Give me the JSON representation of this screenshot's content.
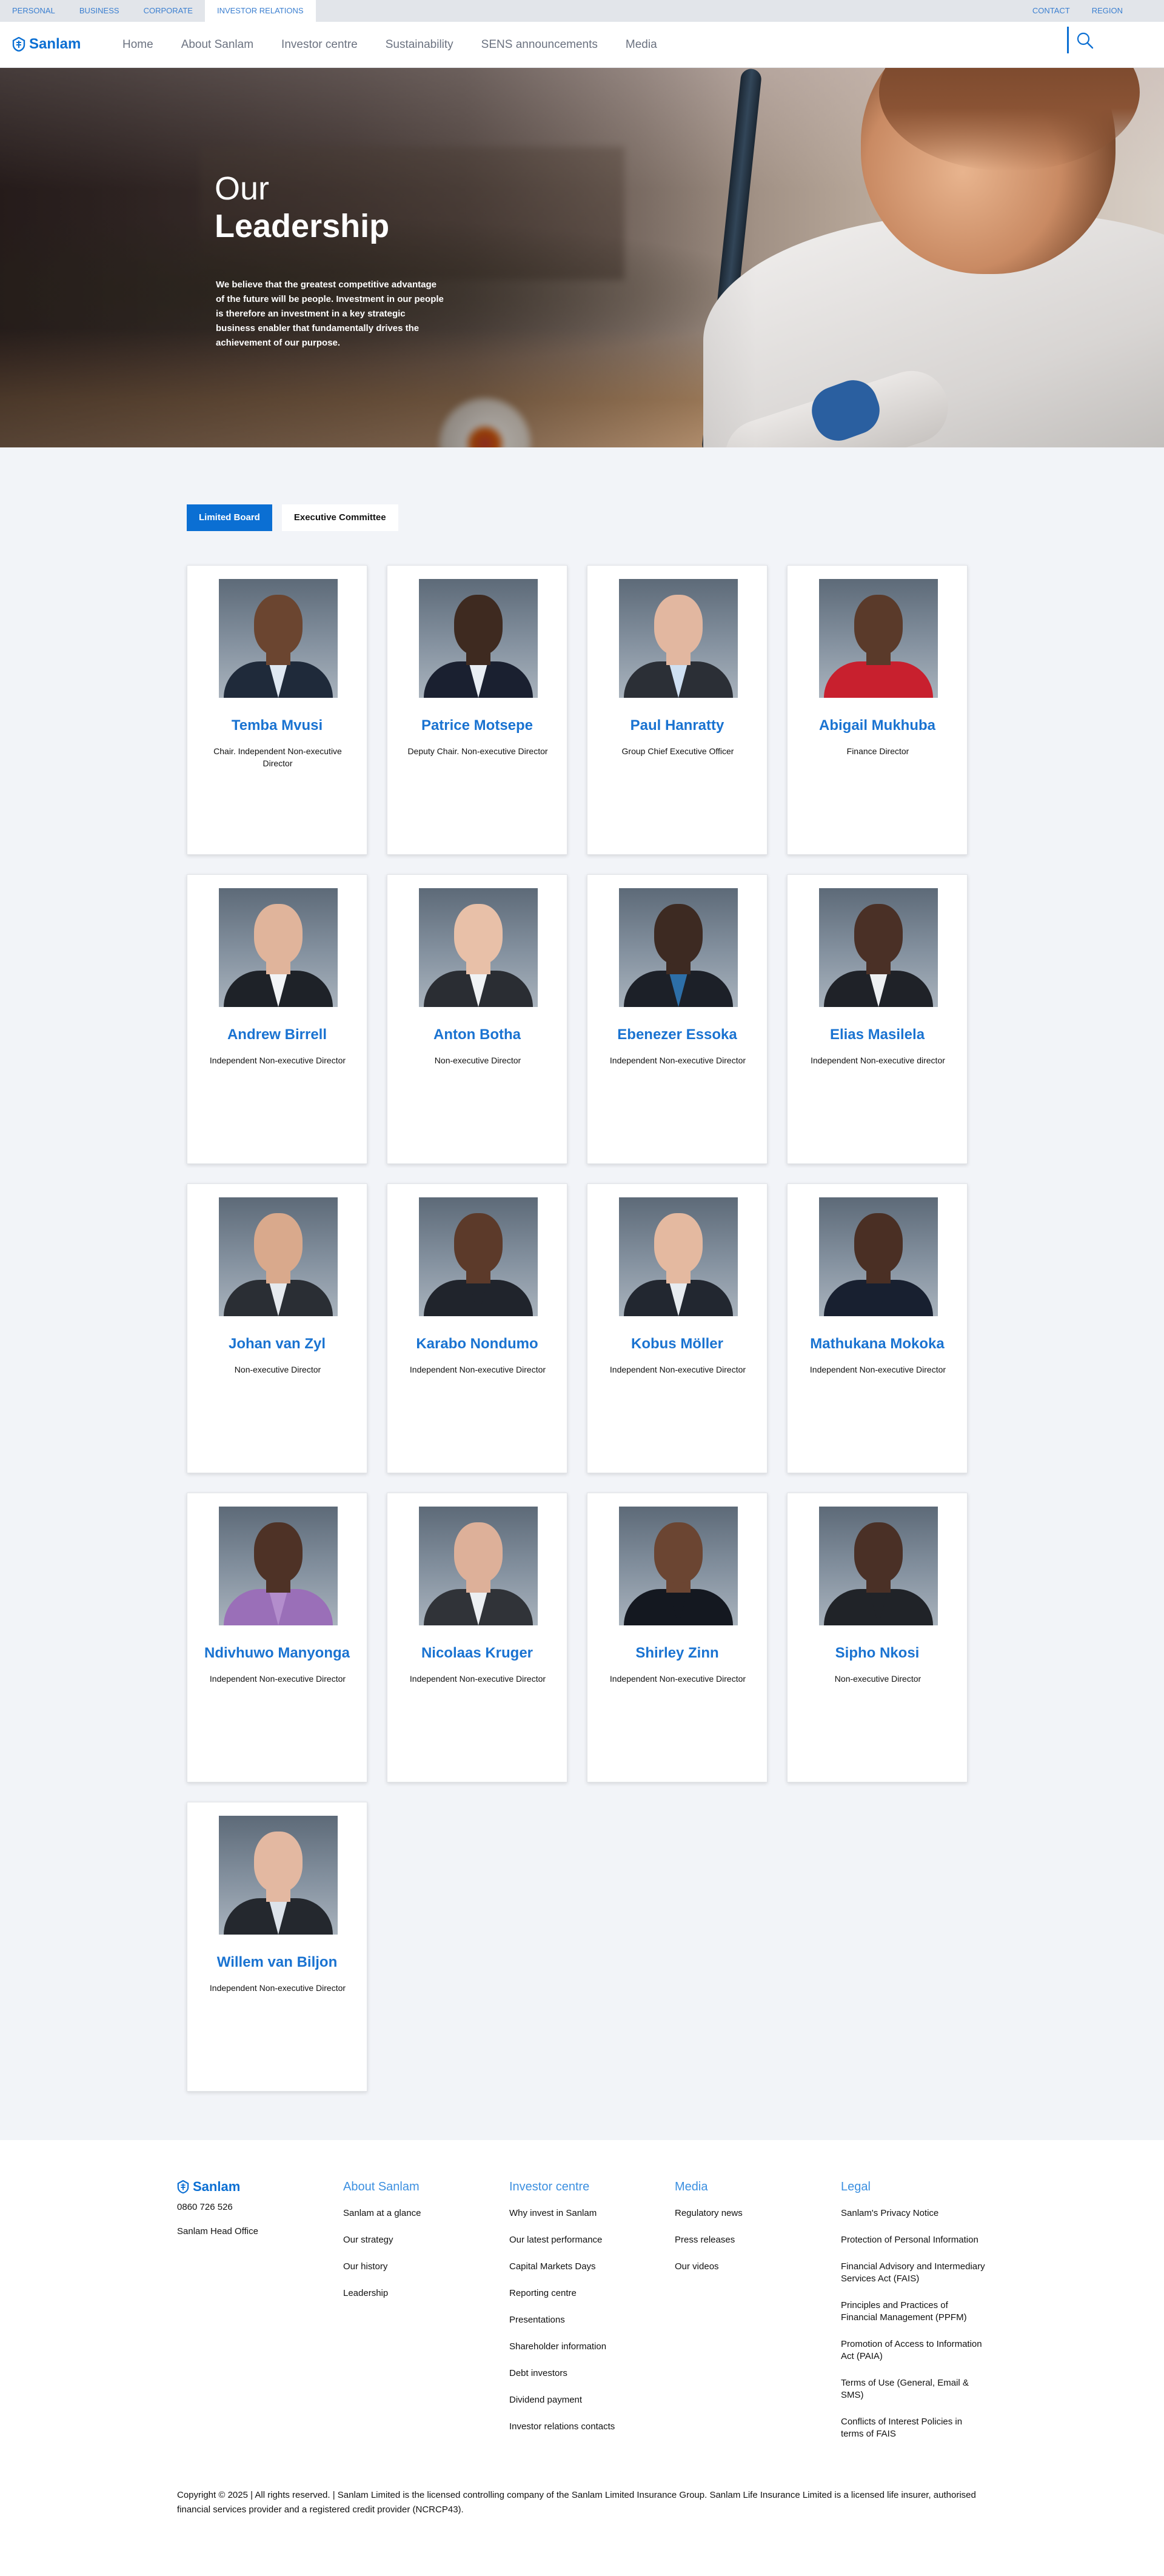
{
  "utility_nav": {
    "items": [
      "PERSONAL",
      "BUSINESS",
      "CORPORATE",
      "INVESTOR RELATIONS"
    ],
    "active": "INVESTOR RELATIONS",
    "right": [
      "CONTACT",
      "REGION"
    ]
  },
  "brand": {
    "name": "Sanlam",
    "color": "#0b6fd3"
  },
  "main_nav": [
    "Home",
    "About Sanlam",
    "Investor centre",
    "Sustainability",
    "SENS announcements",
    "Media"
  ],
  "hero": {
    "title_line1": "Our",
    "title_line2": "Leadership",
    "text": "We believe that the greatest competitive advantage of the future will be people. Investment in our people is therefore an investment in a key strategic business enabler that fundamentally drives the achievement of our purpose."
  },
  "tabs": [
    {
      "label": "Limited Board",
      "active": true
    },
    {
      "label": "Executive Committee",
      "active": false
    }
  ],
  "people": [
    {
      "name": "Temba Mvusi",
      "role": "Chair. Independent Non-executive Director",
      "skin": "#6b4530",
      "suit": "#1f2a3a",
      "shirt": "#dfe8f2"
    },
    {
      "name": "Patrice Motsepe",
      "role": "Deputy Chair. Non-executive Director",
      "skin": "#3e2a20",
      "suit": "#1a2030",
      "shirt": "#e9eef4"
    },
    {
      "name": "Paul Hanratty",
      "role": "Group Chief Executive Officer",
      "skin": "#e2b7a0",
      "suit": "#2b2f36",
      "shirt": "#cfe0f2"
    },
    {
      "name": "Abigail Mukhuba",
      "role": "Finance Director",
      "skin": "#5a3a2a",
      "suit": "#c8202e",
      "shirt": "#c8202e"
    },
    {
      "name": "Andrew Birrell",
      "role": "Independent Non-executive Director",
      "skin": "#e0b49b",
      "suit": "#1e2228",
      "shirt": "#f2f4f6"
    },
    {
      "name": "Anton Botha",
      "role": "Non-executive Director",
      "skin": "#e8c0a8",
      "suit": "#2a2d33",
      "shirt": "#f0f2f4"
    },
    {
      "name": "Ebenezer Essoka",
      "role": "Independent Non-executive Director",
      "skin": "#3d2a22",
      "suit": "#1c2028",
      "shirt": "#2d6fa8"
    },
    {
      "name": "Elias Masilela",
      "role": "Independent Non-executive director",
      "skin": "#4a3026",
      "suit": "#1f2228",
      "shirt": "#eef0f2"
    },
    {
      "name": "Johan van Zyl",
      "role": "Non-executive Director",
      "skin": "#d9a98c",
      "suit": "#2a2e34",
      "shirt": "#e6eaee"
    },
    {
      "name": "Karabo Nondumo",
      "role": "Independent Non-executive Director",
      "skin": "#5c3a2a",
      "suit": "#20242c",
      "shirt": "#20242c"
    },
    {
      "name": "Kobus Möller",
      "role": "Independent Non-executive Director",
      "skin": "#e4b9a0",
      "suit": "#222730",
      "shirt": "#e8ecf0"
    },
    {
      "name": "Mathukana Mokoka",
      "role": "Independent Non-executive Director",
      "skin": "#4a2f24",
      "suit": "#182030",
      "shirt": "#182030"
    },
    {
      "name": "Ndivhuwo Manyonga",
      "role": "Independent Non-executive Director",
      "skin": "#4e3226",
      "suit": "#9a6fb8",
      "shirt": "#b38dcc"
    },
    {
      "name": "Nicolaas Kruger",
      "role": "Independent Non-executive Director",
      "skin": "#ddb099",
      "suit": "#303338",
      "shirt": "#eceff2"
    },
    {
      "name": "Shirley Zinn",
      "role": "Independent Non-executive Director",
      "skin": "#6b4532",
      "suit": "#141820",
      "shirt": "#141820"
    },
    {
      "name": "Sipho Nkosi",
      "role": "Non-executive Director",
      "skin": "#4a3026",
      "suit": "#202328",
      "shirt": "#202328"
    },
    {
      "name": "Willem van Biljon",
      "role": "Independent Non-executive Director",
      "skin": "#e3b8a1",
      "suit": "#24282e",
      "shirt": "#dde3ea"
    }
  ],
  "footer": {
    "phone": "0860 726 526",
    "office": "Sanlam Head Office",
    "columns": [
      {
        "title": "About Sanlam",
        "links": [
          "Sanlam at a glance",
          "Our strategy",
          "Our history",
          "Leadership"
        ]
      },
      {
        "title": "Investor centre",
        "links": [
          "Why invest in Sanlam",
          "Our latest performance",
          "Capital Markets Days",
          "Reporting centre",
          "Presentations",
          "Shareholder information",
          "Debt investors",
          "Dividend payment",
          "Investor relations contacts"
        ]
      },
      {
        "title": "Media",
        "links": [
          "Regulatory news",
          "Press releases",
          "Our videos"
        ]
      },
      {
        "title": "Legal",
        "links": [
          "Sanlam's Privacy Notice",
          "Protection of Personal Information",
          "Financial Advisory and Intermediary Services Act (FAIS)",
          "Principles and Practices of Financial Management (PPFM)",
          "Promotion of Access to Information Act (PAIA)",
          "Terms of Use (General, Email & SMS)",
          "Conflicts of Interest Policies in terms of FAIS"
        ]
      }
    ],
    "copyright": "Copyright © 2025 | All rights reserved. | Sanlam Limited is the licensed controlling company of the Sanlam Limited Insurance Group. Sanlam Life Insurance Limited is a licensed life insurer, authorised financial services provider and a registered credit provider (NCRCP43)."
  }
}
